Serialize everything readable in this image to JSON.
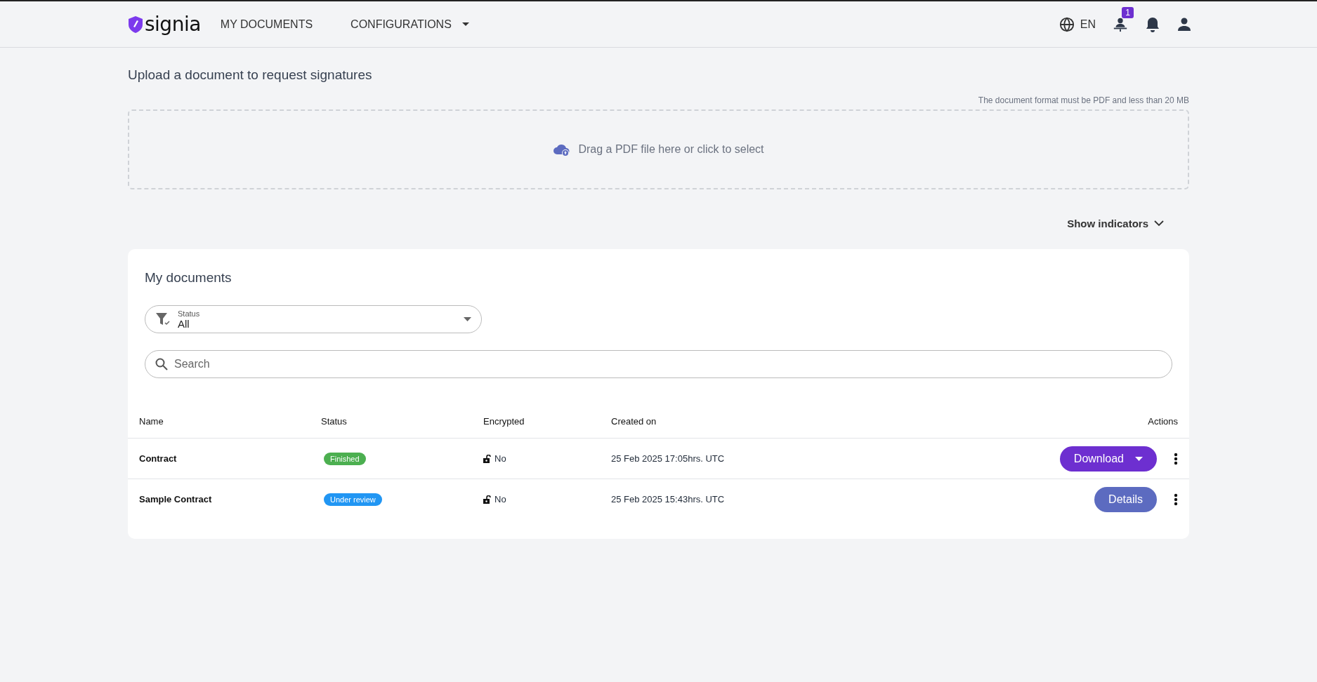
{
  "header": {
    "logo": "signia",
    "nav": [
      {
        "label": "MY DOCUMENTS",
        "dropdown": false
      },
      {
        "label": "CONFIGURATIONS",
        "dropdown": true
      }
    ],
    "language": "EN",
    "badge": "1"
  },
  "upload": {
    "title": "Upload a document to request signatures",
    "note": "The document format must be PDF and less than 20 MB",
    "dropzone": "Drag a PDF file here or click to select"
  },
  "indicators": {
    "label": "Show indicators",
    "expanded": false
  },
  "documents": {
    "title": "My documents",
    "filter": {
      "label": "Status",
      "value": "All"
    },
    "search": {
      "placeholder": "Search"
    },
    "columns": [
      "Name",
      "Status",
      "Encrypted",
      "Created on",
      "Actions"
    ],
    "rows": [
      {
        "name": "Contract",
        "status": {
          "label": "Finished",
          "color": "#4caf50"
        },
        "encrypted": "No",
        "created": "25 Feb 2025 17:05hrs. UTC",
        "action": {
          "label": "Download",
          "kind": "dropdown"
        }
      },
      {
        "name": "Sample Contract",
        "status": {
          "label": "Under review",
          "color": "#2196f3"
        },
        "encrypted": "No",
        "created": "25 Feb 2025 15:43hrs. UTC",
        "action": {
          "label": "Details",
          "kind": "plain"
        }
      }
    ]
  }
}
